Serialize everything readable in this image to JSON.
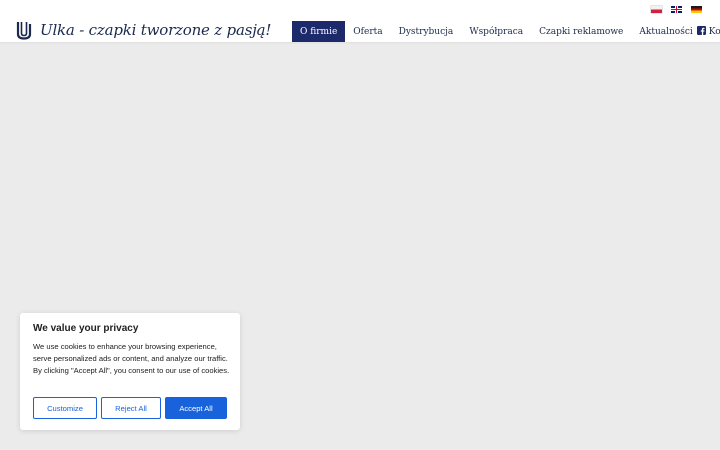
{
  "languages": [
    {
      "code": "pl",
      "icon": "poland-flag-icon"
    },
    {
      "code": "en",
      "icon": "uk-flag-icon"
    },
    {
      "code": "de",
      "icon": "germany-flag-icon"
    }
  ],
  "header": {
    "logo_icon": "ulka-logo-icon",
    "site_title": "Ulka - czapki tworzone z pasją!",
    "brand_color": "#1c2a6b",
    "nav": [
      {
        "label": "O firmie",
        "active": true
      },
      {
        "label": "Oferta",
        "active": false
      },
      {
        "label": "Dystrybucja",
        "active": false
      },
      {
        "label": "Współpraca",
        "active": false
      },
      {
        "label": "Czapki reklamowe",
        "active": false
      },
      {
        "label": "Aktualności",
        "active": false
      },
      {
        "label": "Kontakt",
        "active": false
      }
    ],
    "social_icon": "facebook-icon"
  },
  "cookie_banner": {
    "title": "We value your privacy",
    "text": "We use cookies to enhance your browsing experience, serve personalized ads or content, and analyze our traffic. By clicking \"Accept All\", you consent to our use of cookies.",
    "buttons": {
      "customize": "Customize",
      "reject": "Reject All",
      "accept": "Accept All"
    },
    "accent_color": "#1863dc"
  }
}
